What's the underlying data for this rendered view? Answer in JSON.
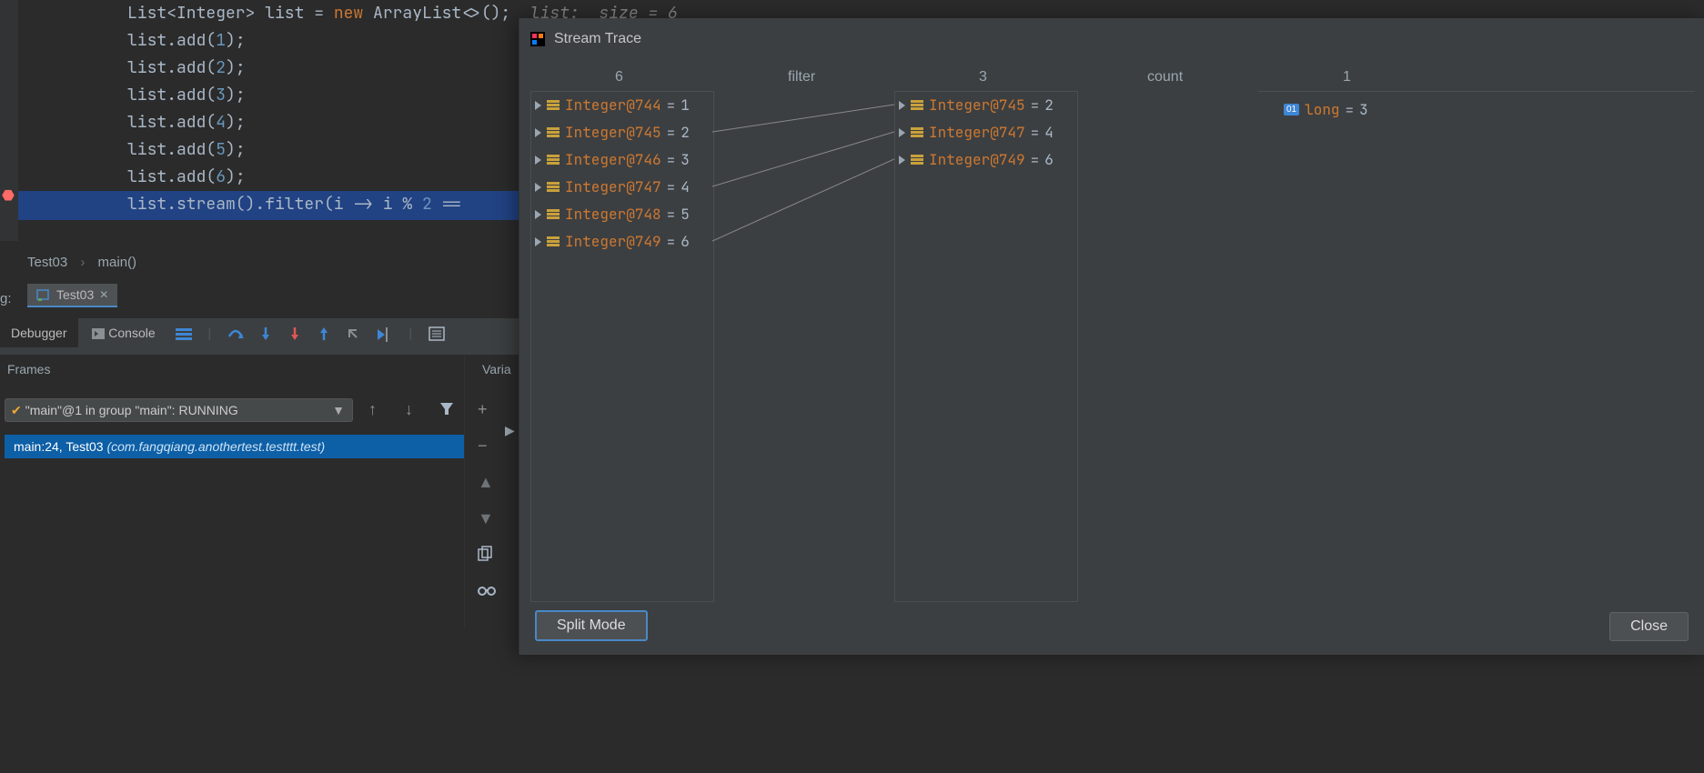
{
  "editor": {
    "l1_a": "List<Integer> list = ",
    "l1_b": "new",
    "l1_c": " ArrayList<>();",
    "l1_hint": "  list:  size = 6",
    "lines": [
      "list.add(1);",
      "list.add(2);",
      "list.add(3);",
      "list.add(4);",
      "list.add(5);",
      "list.add(6);"
    ],
    "hl": "list.stream().filter(i -> i % 2 =="
  },
  "crumbs": {
    "cls": "Test03",
    "method": "main()"
  },
  "tool": {
    "label": "g:",
    "tab": "Test03"
  },
  "dbg": {
    "debugger": "Debugger",
    "console": "Console",
    "frames": "Frames",
    "vars": "Varia"
  },
  "thread": {
    "text": "\"main\"@1 in group \"main\": RUNNING"
  },
  "frame": {
    "loc": "main:24, Test03 ",
    "pkg": "(com.fangqiang.anothertest.testttt.test)"
  },
  "panel": {
    "title": "Stream Trace",
    "heads": {
      "c1": "6",
      "op1": "filter",
      "c2": "3",
      "op2": "count",
      "c3": "1"
    },
    "col1": [
      {
        "obj": "Integer@744",
        "v": "1"
      },
      {
        "obj": "Integer@745",
        "v": "2"
      },
      {
        "obj": "Integer@746",
        "v": "3"
      },
      {
        "obj": "Integer@747",
        "v": "4"
      },
      {
        "obj": "Integer@748",
        "v": "5"
      },
      {
        "obj": "Integer@749",
        "v": "6"
      }
    ],
    "col2": [
      {
        "obj": "Integer@745",
        "v": "2"
      },
      {
        "obj": "Integer@747",
        "v": "4"
      },
      {
        "obj": "Integer@749",
        "v": "6"
      }
    ],
    "result": {
      "type": "long",
      "v": "3"
    },
    "split": "Split Mode",
    "close": "Close"
  }
}
